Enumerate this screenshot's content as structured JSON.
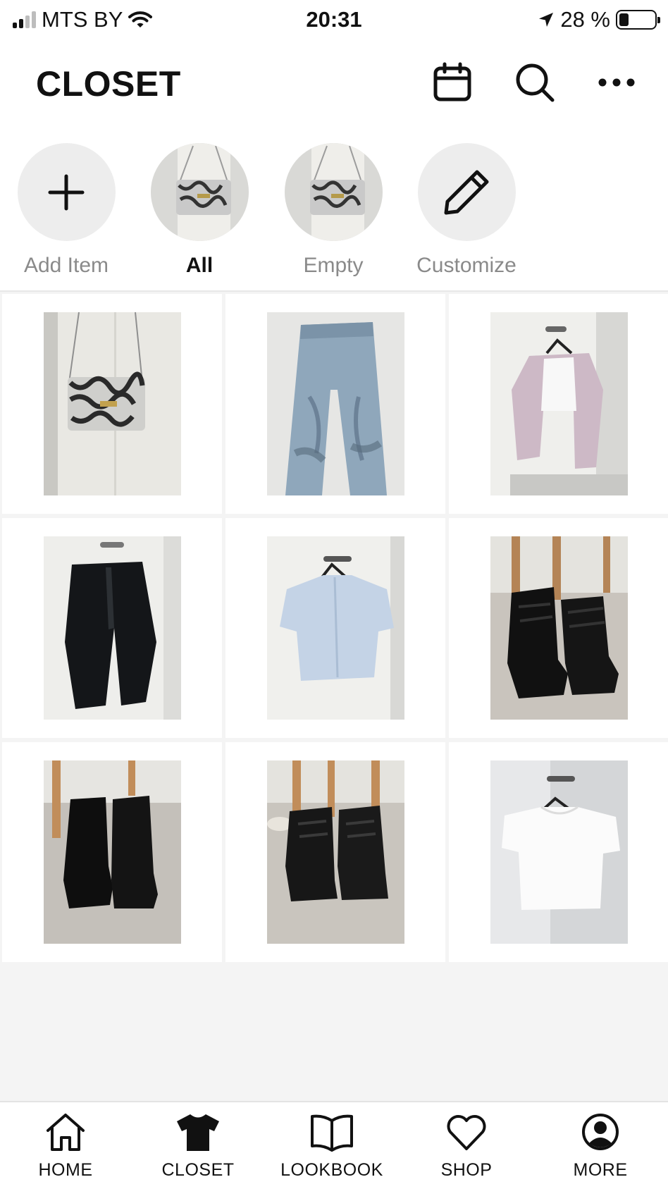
{
  "status_bar": {
    "carrier": "MTS BY",
    "time": "20:31",
    "battery": "28 %",
    "battery_level": 0.28
  },
  "header": {
    "title": "CLOSET",
    "icons": [
      "calendar-icon",
      "search-icon",
      "more-icon"
    ]
  },
  "categories": [
    {
      "label": "Add Item",
      "icon": "plus-icon",
      "active": false
    },
    {
      "label": "All",
      "icon": "bag-thumbnail",
      "active": true
    },
    {
      "label": "Empty",
      "icon": "bag-thumbnail",
      "active": false
    },
    {
      "label": "Customize",
      "icon": "pencil-icon",
      "active": false
    }
  ],
  "items": [
    {
      "kind": "snakeskin-bag"
    },
    {
      "kind": "jeans"
    },
    {
      "kind": "pink-blazer"
    },
    {
      "kind": "black-blazer"
    },
    {
      "kind": "blue-shirt"
    },
    {
      "kind": "black-lace-boots"
    },
    {
      "kind": "black-chelsea-boots"
    },
    {
      "kind": "black-platform-boots"
    },
    {
      "kind": "white-tshirt"
    }
  ],
  "tabbar": {
    "active": "CLOSET",
    "tabs": [
      {
        "label": "HOME",
        "icon": "home-icon"
      },
      {
        "label": "CLOSET",
        "icon": "tshirt-icon"
      },
      {
        "label": "LOOKBOOK",
        "icon": "book-icon"
      },
      {
        "label": "SHOP",
        "icon": "heart-icon"
      },
      {
        "label": "MORE",
        "icon": "profile-icon"
      }
    ]
  },
  "colors": {
    "accent": "#111111",
    "inactive_text": "#8a8a8a",
    "circle_bg": "#ededed",
    "page_bg": "#f4f4f4"
  }
}
